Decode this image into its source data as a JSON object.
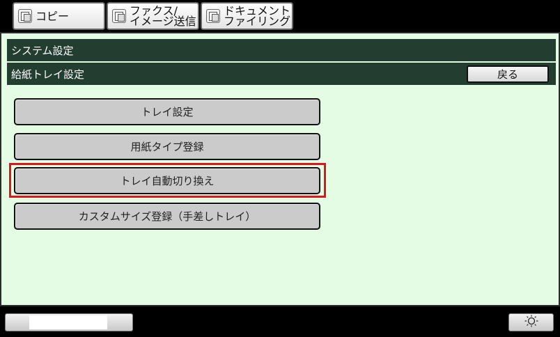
{
  "tabs": [
    {
      "label": "コピー",
      "icon": "copy-icon"
    },
    {
      "label": "ファクス/\nイメージ送信",
      "icon": "fax-image-send-icon"
    },
    {
      "label": "ドキュメント\nファイリング",
      "icon": "document-filing-icon"
    }
  ],
  "header": {
    "breadcrumb_title": "システム設定",
    "section_title": "給紙トレイ設定",
    "back_label": "戻る"
  },
  "menu": [
    {
      "label": "トレイ設定"
    },
    {
      "label": "用紙タイプ登録"
    },
    {
      "label": "トレイ自動切り換え",
      "highlighted": true
    },
    {
      "label": "カスタムサイズ登録（手差しトレイ）"
    }
  ],
  "colors": {
    "panel_bg": "#e3fce3",
    "bar_bg": "#233e31",
    "highlight": "#e2141b"
  },
  "footer": {
    "brightness_icon": "brightness-icon"
  }
}
